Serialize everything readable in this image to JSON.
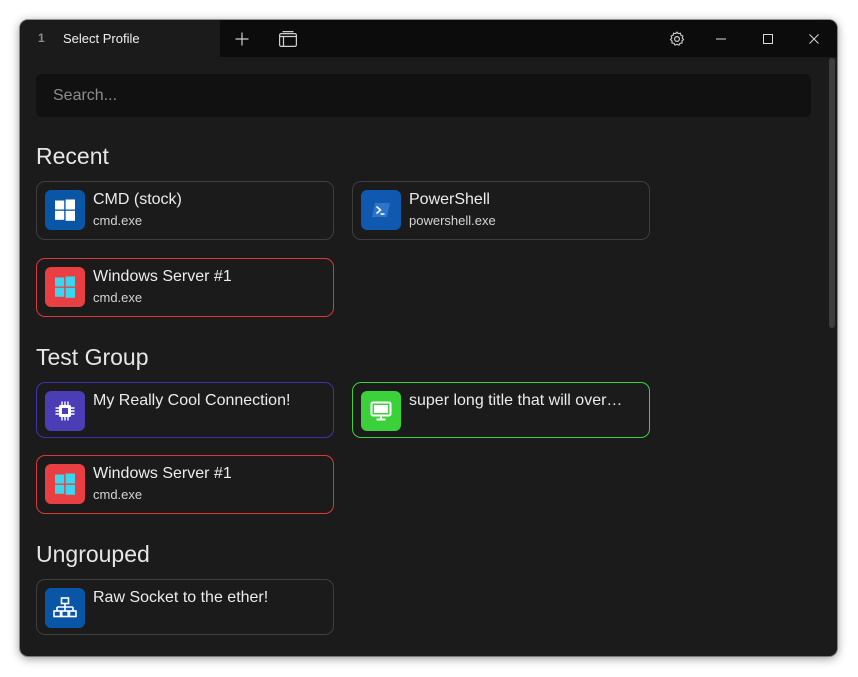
{
  "tab": {
    "number": "1",
    "title": "Select Profile"
  },
  "search": {
    "placeholder": "Search..."
  },
  "colors": {
    "cmd_icon_bg": "#0a56a6",
    "powershell_icon_bg": "#0f5ab0",
    "server_icon_bg": "#e93f42",
    "server_border": "#d9383d",
    "cool_icon_bg": "#4a3db5",
    "cool_border": "#3a34a8",
    "long_icon_bg": "#3bd13b",
    "long_border": "#3bd13b",
    "socket_icon_bg": "#0a56a6"
  },
  "groups": [
    {
      "title": "Recent",
      "cards": [
        {
          "title": "CMD (stock)",
          "subtitle": "cmd.exe",
          "icon": "windows-icon"
        },
        {
          "title": "PowerShell",
          "subtitle": "powershell.exe",
          "icon": "powershell-icon"
        },
        {
          "title": "Windows Server #1",
          "subtitle": "cmd.exe",
          "icon": "windows-icon"
        }
      ]
    },
    {
      "title": "Test Group",
      "cards": [
        {
          "title": "My Really Cool Connection!",
          "icon": "cpu-chip-icon"
        },
        {
          "title": "super long title that will over…",
          "icon": "monitor-icon"
        },
        {
          "title": "Windows Server #1",
          "subtitle": "cmd.exe",
          "icon": "windows-icon"
        }
      ]
    },
    {
      "title": "Ungrouped",
      "cards": [
        {
          "title": "Raw Socket to the ether!",
          "icon": "network-icon"
        }
      ]
    }
  ]
}
